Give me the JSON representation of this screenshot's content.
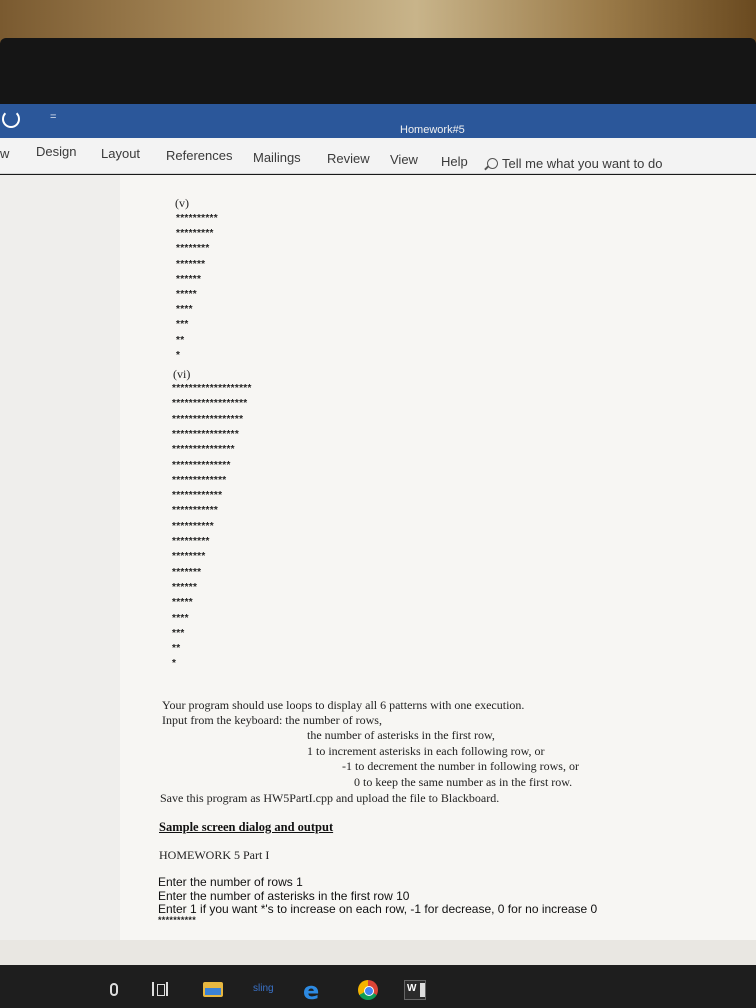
{
  "window": {
    "title": "Homework#5",
    "qat_more": "="
  },
  "ribbon": {
    "tabs": [
      {
        "label": "w"
      },
      {
        "label": "Design"
      },
      {
        "label": "Layout"
      },
      {
        "label": "References"
      },
      {
        "label": "Mailings"
      },
      {
        "label": "Review"
      },
      {
        "label": "View"
      },
      {
        "label": "Help"
      }
    ],
    "tell_me": "Tell me what you want to do"
  },
  "document": {
    "pattern_v": {
      "label": "(v)",
      "rows": [
        "**********",
        "*********",
        "********",
        "*******",
        "******",
        "*****",
        "****",
        "***",
        "**",
        "*"
      ]
    },
    "pattern_vi": {
      "label": "(vi)",
      "rows": [
        "*******************",
        "******************",
        "*****************",
        "****************",
        "***************",
        "**************",
        "*************",
        "************",
        "***********",
        "**********",
        "*********",
        "********",
        "*******",
        "******",
        "*****",
        "****",
        "***",
        "**",
        "*"
      ]
    },
    "instructions": {
      "line1": "Your program should use loops to display all 6 patterns with one execution.",
      "line2": "Input from the keyboard: the number of rows,",
      "line3": "the number of asterisks in the first row,",
      "line4": "1 to increment asterisks in each following row, or",
      "line5": "-1 to decrement the number in following rows, or",
      "line6": "0 to keep the same number as in the first row.",
      "line7": "Save this program as HW5PartI.cpp and upload the file to Blackboard."
    },
    "sample": {
      "heading": "Sample screen dialog and output",
      "title": "HOMEWORK 5 Part I",
      "line1": "Enter the number of rows 1",
      "line2": "Enter the number of asterisks in the first row 10",
      "line3": "Enter 1 if you want *'s to increase on each row, -1 for decrease, 0 for no increase 0",
      "line4": "**********"
    }
  },
  "taskbar": {
    "sling_label": "sling",
    "word_label": "W"
  }
}
